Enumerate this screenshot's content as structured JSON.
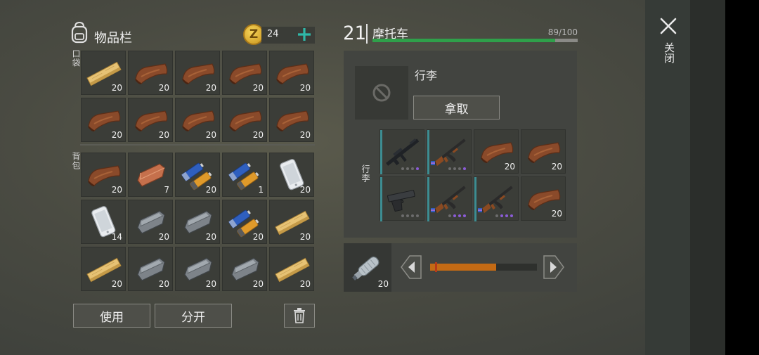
{
  "inventory": {
    "title": "物品栏",
    "coins": "24",
    "pocket_label": "口袋",
    "backpack_label": "背包",
    "pocket": [
      {
        "item": "plank",
        "count": "20"
      },
      {
        "item": "leather",
        "count": "20"
      },
      {
        "item": "leather",
        "count": "20"
      },
      {
        "item": "leather",
        "count": "20"
      },
      {
        "item": "leather",
        "count": "20"
      },
      {
        "item": "leather",
        "count": "20"
      },
      {
        "item": "leather",
        "count": "20"
      },
      {
        "item": "leather",
        "count": "20"
      },
      {
        "item": "leather",
        "count": "20"
      },
      {
        "item": "leather",
        "count": "20"
      }
    ],
    "backpack": [
      {
        "item": "leather",
        "count": "20"
      },
      {
        "item": "copper-ingot",
        "count": "7"
      },
      {
        "item": "batteries",
        "count": "20"
      },
      {
        "item": "batteries",
        "count": "1"
      },
      {
        "item": "smartphone",
        "count": "20"
      },
      {
        "item": "smartphone",
        "count": "14"
      },
      {
        "item": "iron-ingot",
        "count": "20"
      },
      {
        "item": "iron-ingot",
        "count": "20"
      },
      {
        "item": "batteries",
        "count": "20"
      },
      {
        "item": "plank",
        "count": "20"
      },
      {
        "item": "plank",
        "count": "20"
      },
      {
        "item": "iron-ingot",
        "count": "20"
      },
      {
        "item": "iron-ingot",
        "count": "20"
      },
      {
        "item": "iron-ingot",
        "count": "20"
      },
      {
        "item": "plank",
        "count": "20"
      }
    ],
    "use_label": "使用",
    "split_label": "分开"
  },
  "vehicle": {
    "level": "21",
    "name": "摩托车",
    "durability_text": "89/100",
    "durability": 0.89,
    "bay_label": "行李",
    "take_label": "拿取",
    "storage_label": "行李",
    "storage": [
      {
        "item": "m16-rifle",
        "count": ""
      },
      {
        "item": "ak-rifle",
        "count": ""
      },
      {
        "item": "leather",
        "count": "20"
      },
      {
        "item": "leather",
        "count": "20"
      },
      {
        "item": "pistol",
        "count": ""
      },
      {
        "item": "ak-rifle",
        "count": ""
      },
      {
        "item": "ak-rifle",
        "count": ""
      },
      {
        "item": "leather",
        "count": "20"
      }
    ],
    "fuel_count": "20",
    "fuel_level": 0.62
  },
  "close_label": "关闭",
  "colors": {
    "accent": "#2fb8a8",
    "durability_bar": "#2fa04a",
    "fuel_bar": "#c46a14",
    "quality_purple": "#8b5cd6"
  }
}
